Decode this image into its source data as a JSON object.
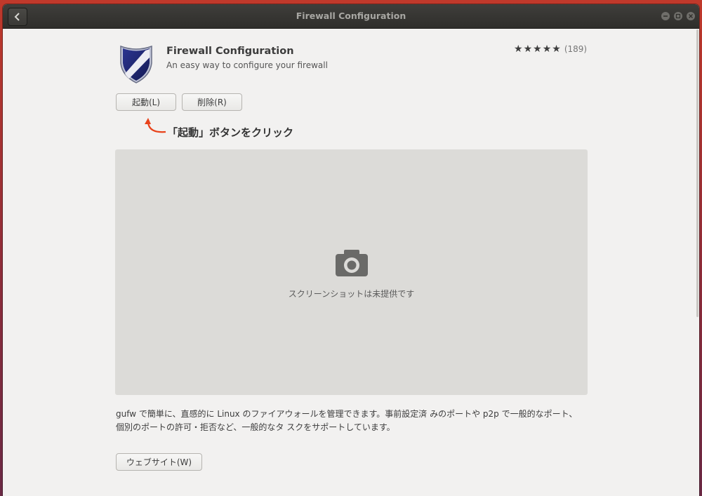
{
  "window": {
    "title": "Firewall Configuration"
  },
  "app": {
    "name": "Firewall Configuration",
    "summary": "An easy way to configure your firewall",
    "rating_count": "(189)",
    "stars": 5
  },
  "buttons": {
    "launch": "起動(L)",
    "remove": "削除(R)",
    "website": "ウェブサイト(W)"
  },
  "annotation": "「起動」ボタンをクリック",
  "screenshot": {
    "placeholder": "スクリーンショットは未提供です"
  },
  "description": {
    "line1": "gufw で簡単に、直感的に Linux のファイアウォールを管理できます。事前設定済 みのポートや p2p で一般的なポート、",
    "line2": "個別のポートの許可・拒否など、一般的なタ スクをサポートしています。"
  },
  "colors": {
    "annotation_arrow": "#e8431b",
    "titlebar": "#3a3936"
  }
}
